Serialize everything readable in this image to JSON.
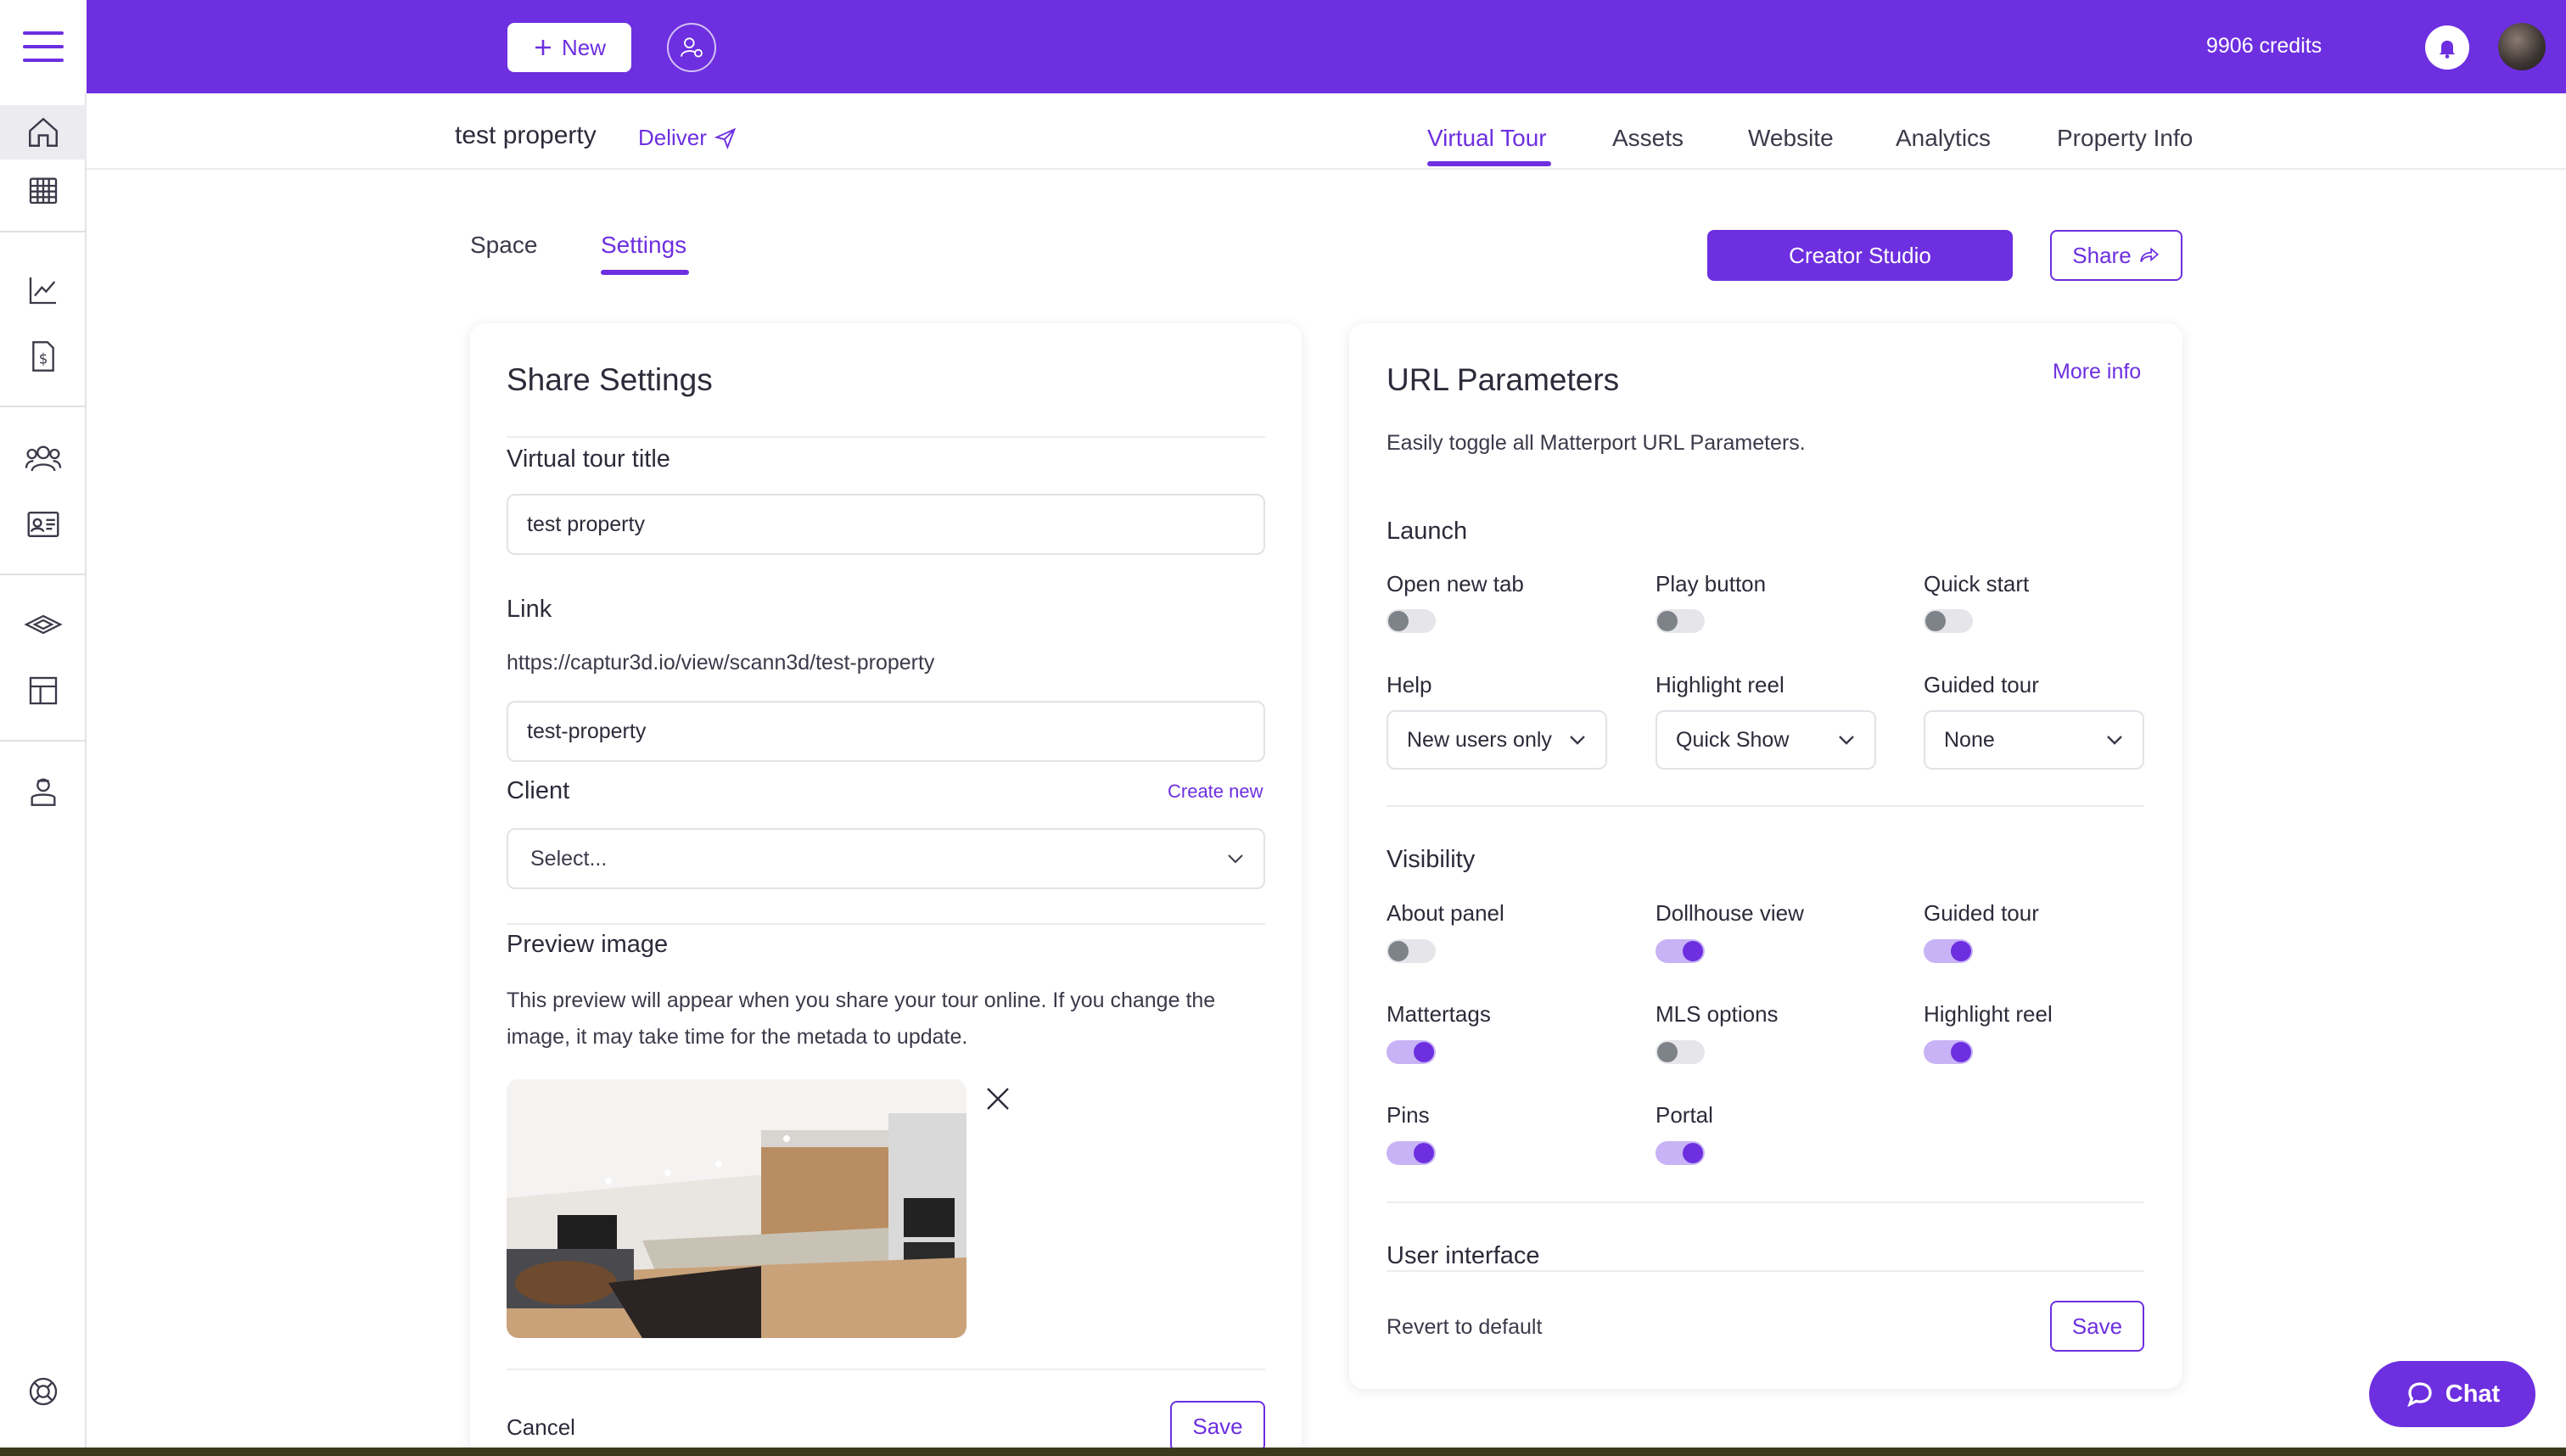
{
  "topbar": {
    "new_label": "New",
    "credits": "9906 credits",
    "accent": "#6d2fe0"
  },
  "property": {
    "title": "test property",
    "deliver_label": "Deliver"
  },
  "top_tabs": [
    {
      "label": "Virtual Tour",
      "active": true
    },
    {
      "label": "Assets",
      "active": false
    },
    {
      "label": "Website",
      "active": false
    },
    {
      "label": "Analytics",
      "active": false
    },
    {
      "label": "Property Info",
      "active": false
    }
  ],
  "sub_tabs": [
    {
      "label": "Space",
      "active": false
    },
    {
      "label": "Settings",
      "active": true
    }
  ],
  "actions": {
    "creator_studio": "Creator Studio",
    "share": "Share"
  },
  "share_settings": {
    "title": "Share Settings",
    "tour_title_label": "Virtual tour title",
    "tour_title_value": "test property",
    "link_label": "Link",
    "link_url": "https://captur3d.io/view/scann3d/test-property",
    "slug_value": "test-property",
    "client_label": "Client",
    "create_new": "Create new",
    "client_placeholder": "Select...",
    "preview_label": "Preview image",
    "preview_desc": "This preview will appear when you share your tour online. If you change the image, it may take time for the metada to update.",
    "cancel": "Cancel",
    "save": "Save"
  },
  "url_params": {
    "title": "URL Parameters",
    "more_info": "More info",
    "desc": "Easily toggle all Matterport URL Parameters.",
    "launch_title": "Launch",
    "launch_toggles": [
      {
        "label": "Open new tab",
        "on": false
      },
      {
        "label": "Play button",
        "on": false
      },
      {
        "label": "Quick start",
        "on": false
      }
    ],
    "launch_selects": [
      {
        "label": "Help",
        "value": "New users only"
      },
      {
        "label": "Highlight reel",
        "value": "Quick Show"
      },
      {
        "label": "Guided tour",
        "value": "None"
      }
    ],
    "visibility_title": "Visibility",
    "visibility_toggles": [
      {
        "label": "About panel",
        "on": false
      },
      {
        "label": "Dollhouse view",
        "on": true
      },
      {
        "label": "Guided tour",
        "on": true
      },
      {
        "label": "Mattertags",
        "on": true
      },
      {
        "label": "MLS options",
        "on": false
      },
      {
        "label": "Highlight reel",
        "on": true
      },
      {
        "label": "Pins",
        "on": true
      },
      {
        "label": "Portal",
        "on": true
      }
    ],
    "ui_title": "User interface",
    "revert": "Revert to default",
    "save": "Save"
  },
  "chat": {
    "label": "Chat"
  },
  "icons": {
    "menu": "hamburger-menu-icon",
    "nav": [
      "home-icon",
      "calendar-icon",
      "analytics-chart-icon",
      "invoice-icon",
      "team-icon",
      "contact-card-icon",
      "layers-icon",
      "layout-icon",
      "user-badge-icon",
      "help-lifebuoy-icon"
    ]
  }
}
